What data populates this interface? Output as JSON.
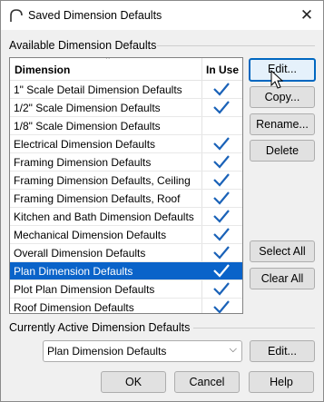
{
  "window": {
    "title": "Saved Dimension Defaults",
    "close_glyph": "✕"
  },
  "available": {
    "group_label": "Available Dimension Defaults",
    "columns": {
      "dimension": "Dimension",
      "in_use": "In Use"
    },
    "rows": [
      {
        "name": "1\" Scale Detail Dimension Defaults",
        "in_use": true
      },
      {
        "name": "1/2\" Scale Dimension Defaults",
        "in_use": true
      },
      {
        "name": "1/8\" Scale Dimension Defaults",
        "in_use": false
      },
      {
        "name": "Electrical Dimension Defaults",
        "in_use": true
      },
      {
        "name": "Framing Dimension Defaults",
        "in_use": true
      },
      {
        "name": "Framing Dimension Defaults, Ceiling",
        "in_use": true
      },
      {
        "name": "Framing Dimension Defaults, Roof",
        "in_use": true
      },
      {
        "name": "Kitchen and Bath Dimension Defaults",
        "in_use": true
      },
      {
        "name": "Mechanical Dimension Defaults",
        "in_use": true
      },
      {
        "name": "Overall Dimension Defaults",
        "in_use": true
      },
      {
        "name": "Plan Dimension Defaults",
        "in_use": true,
        "selected": true
      },
      {
        "name": "Plot Plan Dimension Defaults",
        "in_use": true
      },
      {
        "name": "Roof Dimension Defaults",
        "in_use": true
      }
    ]
  },
  "buttons": {
    "edit": "Edit...",
    "copy": "Copy...",
    "rename": "Rename...",
    "delete": "Delete",
    "select_all": "Select All",
    "clear_all": "Clear All",
    "active_edit": "Edit...",
    "ok": "OK",
    "cancel": "Cancel",
    "help": "Help"
  },
  "active": {
    "group_label": "Currently Active Dimension Defaults",
    "selected_value": "Plan Dimension Defaults"
  },
  "colors": {
    "selection": "#0a63c9",
    "check": "#1a62b8",
    "focus_border": "#0067c0"
  }
}
